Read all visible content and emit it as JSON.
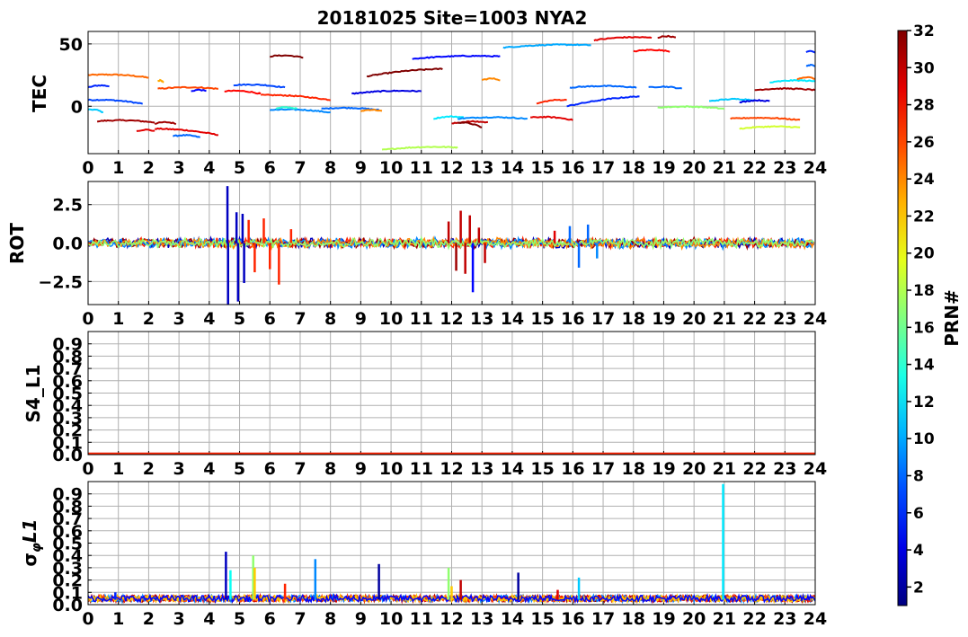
{
  "figure_title": "20181025 Site=1003 NYA2",
  "colorbar": {
    "label": "PRN#",
    "colormap": "jet",
    "range": [
      1,
      32
    ],
    "ticks": [
      2,
      4,
      6,
      8,
      10,
      12,
      14,
      16,
      18,
      20,
      22,
      24,
      26,
      28,
      30,
      32
    ],
    "tick_labels": [
      "2",
      "4",
      "6",
      "8",
      "10",
      "12",
      "14",
      "16",
      "18",
      "20",
      "22",
      "24",
      "26",
      "28",
      "30",
      "32"
    ]
  },
  "chart_data": [
    {
      "type": "line",
      "ylabel": "TEC",
      "xlim": [
        0,
        24
      ],
      "ylim": [
        -38,
        60
      ],
      "x_ticks": [
        "0",
        "1",
        "2",
        "3",
        "4",
        "5",
        "6",
        "7",
        "8",
        "9",
        "10",
        "11",
        "12",
        "13",
        "14",
        "15",
        "16",
        "17",
        "18",
        "19",
        "20",
        "21",
        "22",
        "23",
        "24"
      ],
      "y_ticks": [
        0,
        50
      ],
      "y_tick_labels": [
        "0",
        "50"
      ],
      "grid": true,
      "segments": [
        {
          "prn": 25,
          "x0": 0.0,
          "x1": 2.0,
          "y0": 25,
          "y1": 23
        },
        {
          "prn": 6,
          "x0": 0.0,
          "x1": 0.7,
          "y0": 15,
          "y1": 16
        },
        {
          "prn": 7,
          "x0": 0.0,
          "x1": 1.8,
          "y0": 5,
          "y1": 2
        },
        {
          "prn": 11,
          "x0": 0.0,
          "x1": 0.5,
          "y0": -3,
          "y1": -5
        },
        {
          "prn": 31,
          "x0": 0.3,
          "x1": 2.2,
          "y0": -12,
          "y1": -13
        },
        {
          "prn": 31,
          "x0": 2.2,
          "x1": 2.9,
          "y0": -14,
          "y1": -14
        },
        {
          "prn": 29,
          "x0": 1.6,
          "x1": 2.2,
          "y0": -20,
          "y1": -20
        },
        {
          "prn": 29,
          "x0": 2.2,
          "x1": 4.3,
          "y0": -18,
          "y1": -23
        },
        {
          "prn": 8,
          "x0": 2.8,
          "x1": 3.7,
          "y0": -24,
          "y1": -25
        },
        {
          "prn": 23,
          "x0": 2.3,
          "x1": 2.5,
          "y0": 20,
          "y1": 19
        },
        {
          "prn": 26,
          "x0": 2.3,
          "x1": 4.3,
          "y0": 14,
          "y1": 14
        },
        {
          "prn": 5,
          "x0": 3.4,
          "x1": 3.9,
          "y0": 12,
          "y1": 12
        },
        {
          "prn": 28,
          "x0": 4.5,
          "x1": 5.7,
          "y0": 12,
          "y1": 10
        },
        {
          "prn": 27,
          "x0": 5.7,
          "x1": 8.0,
          "y0": 9,
          "y1": 5
        },
        {
          "prn": 7,
          "x0": 4.8,
          "x1": 6.5,
          "y0": 17,
          "y1": 15
        },
        {
          "prn": 32,
          "x0": 6.0,
          "x1": 7.1,
          "y0": 40,
          "y1": 39
        },
        {
          "prn": 9,
          "x0": 6.0,
          "x1": 8.0,
          "y0": -3,
          "y1": -5
        },
        {
          "prn": 14,
          "x0": 6.2,
          "x1": 6.9,
          "y0": -2,
          "y1": -2
        },
        {
          "prn": 8,
          "x0": 7.7,
          "x1": 9.6,
          "y0": -2,
          "y1": -3
        },
        {
          "prn": 24,
          "x0": 9.0,
          "x1": 9.7,
          "y0": -4,
          "y1": -4
        },
        {
          "prn": 4,
          "x0": 8.7,
          "x1": 11.0,
          "y0": 10,
          "y1": 12
        },
        {
          "prn": 32,
          "x0": 9.2,
          "x1": 11.7,
          "y0": 24,
          "y1": 30
        },
        {
          "prn": 5,
          "x0": 10.7,
          "x1": 13.6,
          "y0": 38,
          "y1": 40
        },
        {
          "prn": 18,
          "x0": 9.7,
          "x1": 12.2,
          "y0": -35,
          "y1": -33
        },
        {
          "prn": 12,
          "x0": 11.4,
          "x1": 12.4,
          "y0": -10,
          "y1": -9
        },
        {
          "prn": 9,
          "x0": 12.2,
          "x1": 14.5,
          "y0": -10,
          "y1": -10
        },
        {
          "prn": 30,
          "x0": 12.0,
          "x1": 13.2,
          "y0": -14,
          "y1": -13
        },
        {
          "prn": 32,
          "x0": 12.2,
          "x1": 13.0,
          "y0": -13,
          "y1": -17
        },
        {
          "prn": 24,
          "x0": 13.0,
          "x1": 13.6,
          "y0": 21,
          "y1": 21
        },
        {
          "prn": 10,
          "x0": 13.7,
          "x1": 16.6,
          "y0": 47,
          "y1": 49
        },
        {
          "prn": 29,
          "x0": 14.6,
          "x1": 16.0,
          "y0": -9,
          "y1": -11
        },
        {
          "prn": 27,
          "x0": 14.8,
          "x1": 15.8,
          "y0": 2,
          "y1": 5
        },
        {
          "prn": 29,
          "x0": 16.7,
          "x1": 18.6,
          "y0": 53,
          "y1": 55
        },
        {
          "prn": 31,
          "x0": 18.8,
          "x1": 19.4,
          "y0": 55,
          "y1": 55
        },
        {
          "prn": 28,
          "x0": 18.0,
          "x1": 19.2,
          "y0": 44,
          "y1": 44
        },
        {
          "prn": 8,
          "x0": 15.9,
          "x1": 18.1,
          "y0": 15,
          "y1": 15
        },
        {
          "prn": 6,
          "x0": 15.8,
          "x1": 18.2,
          "y0": 0,
          "y1": 8
        },
        {
          "prn": 8,
          "x0": 18.5,
          "x1": 19.6,
          "y0": 15,
          "y1": 14
        },
        {
          "prn": 17,
          "x0": 18.8,
          "x1": 21.0,
          "y0": -1,
          "y1": -2
        },
        {
          "prn": 11,
          "x0": 20.5,
          "x1": 22.0,
          "y0": 4,
          "y1": 5
        },
        {
          "prn": 4,
          "x0": 21.5,
          "x1": 22.5,
          "y0": 3,
          "y1": 4
        },
        {
          "prn": 31,
          "x0": 22.0,
          "x1": 24.0,
          "y0": 13,
          "y1": 13
        },
        {
          "prn": 26,
          "x0": 21.2,
          "x1": 23.5,
          "y0": -10,
          "y1": -11
        },
        {
          "prn": 19,
          "x0": 21.5,
          "x1": 23.5,
          "y0": -18,
          "y1": -17
        },
        {
          "prn": 12,
          "x0": 22.5,
          "x1": 24.0,
          "y0": 19,
          "y1": 20
        },
        {
          "prn": 25,
          "x0": 23.4,
          "x1": 24.0,
          "y0": 22,
          "y1": 22
        },
        {
          "prn": 8,
          "x0": 23.7,
          "x1": 24.0,
          "y0": 32,
          "y1": 32
        },
        {
          "prn": 6,
          "x0": 23.7,
          "x1": 24.0,
          "y0": 43,
          "y1": 43
        }
      ]
    },
    {
      "type": "line",
      "ylabel": "ROT",
      "xlim": [
        0,
        24
      ],
      "ylim": [
        -4,
        4
      ],
      "x_ticks": [
        "0",
        "1",
        "2",
        "3",
        "4",
        "5",
        "6",
        "7",
        "8",
        "9",
        "10",
        "11",
        "12",
        "13",
        "14",
        "15",
        "16",
        "17",
        "18",
        "19",
        "20",
        "21",
        "22",
        "23",
        "24"
      ],
      "y_ticks": [
        -2.5,
        0.0,
        2.5
      ],
      "y_tick_labels": [
        "−2.5",
        "0.0",
        "2.5"
      ],
      "grid": true,
      "baseline_noise": 0.25,
      "spikes": [
        {
          "x": 4.6,
          "y": 3.7,
          "prn": 3
        },
        {
          "x": 4.62,
          "y": -4.0,
          "prn": 3
        },
        {
          "x": 4.9,
          "y": 2.0,
          "prn": 3
        },
        {
          "x": 4.95,
          "y": -3.8,
          "prn": 3
        },
        {
          "x": 5.1,
          "y": 1.9,
          "prn": 3
        },
        {
          "x": 5.15,
          "y": -2.6,
          "prn": 3
        },
        {
          "x": 5.3,
          "y": 1.5,
          "prn": 27
        },
        {
          "x": 5.5,
          "y": -1.9,
          "prn": 27
        },
        {
          "x": 5.8,
          "y": 1.6,
          "prn": 27
        },
        {
          "x": 6.0,
          "y": -1.7,
          "prn": 27
        },
        {
          "x": 6.3,
          "y": -2.7,
          "prn": 27
        },
        {
          "x": 6.7,
          "y": 0.9,
          "prn": 27
        },
        {
          "x": 11.9,
          "y": 1.4,
          "prn": 30
        },
        {
          "x": 12.15,
          "y": -1.8,
          "prn": 31
        },
        {
          "x": 12.3,
          "y": 2.1,
          "prn": 30
        },
        {
          "x": 12.45,
          "y": -2.0,
          "prn": 30
        },
        {
          "x": 12.6,
          "y": 1.8,
          "prn": 30
        },
        {
          "x": 12.7,
          "y": -3.2,
          "prn": 5
        },
        {
          "x": 12.9,
          "y": 1.0,
          "prn": 30
        },
        {
          "x": 13.1,
          "y": -1.3,
          "prn": 30
        },
        {
          "x": 15.9,
          "y": 1.1,
          "prn": 8
        },
        {
          "x": 16.2,
          "y": -1.6,
          "prn": 8
        },
        {
          "x": 16.5,
          "y": 1.2,
          "prn": 8
        },
        {
          "x": 16.8,
          "y": -1.0,
          "prn": 9
        },
        {
          "x": 15.4,
          "y": 0.8,
          "prn": 29
        }
      ]
    },
    {
      "type": "line",
      "ylabel": "S4_L1",
      "xlim": [
        0,
        24
      ],
      "ylim": [
        0.0,
        1.0
      ],
      "x_ticks": [
        "0",
        "1",
        "2",
        "3",
        "4",
        "5",
        "6",
        "7",
        "8",
        "9",
        "10",
        "11",
        "12",
        "13",
        "14",
        "15",
        "16",
        "17",
        "18",
        "19",
        "20",
        "21",
        "22",
        "23",
        "24"
      ],
      "y_ticks": [
        0.0,
        0.1,
        0.2,
        0.3,
        0.4,
        0.5,
        0.6,
        0.7,
        0.8,
        0.9
      ],
      "y_tick_labels": [
        "0.0",
        "0.1",
        "0.2",
        "0.3",
        "0.4",
        "0.5",
        "0.6",
        "0.7",
        "0.8",
        "0.9"
      ],
      "grid": true,
      "baseline_level": 0.01
    },
    {
      "type": "line",
      "ylabel": "σφL1",
      "ylabel_main": "σ",
      "ylabel_sub": "φ",
      "ylabel_tail": "L1",
      "xlim": [
        0,
        24
      ],
      "ylim": [
        0.0,
        1.0
      ],
      "x_ticks": [
        "0",
        "1",
        "2",
        "3",
        "4",
        "5",
        "6",
        "7",
        "8",
        "9",
        "10",
        "11",
        "12",
        "13",
        "14",
        "15",
        "16",
        "17",
        "18",
        "19",
        "20",
        "21",
        "22",
        "23",
        "24"
      ],
      "y_ticks": [
        0.0,
        0.1,
        0.2,
        0.3,
        0.4,
        0.5,
        0.6,
        0.7,
        0.8,
        0.9
      ],
      "y_tick_labels": [
        "0.0",
        "0.1",
        "0.2",
        "0.3",
        "0.4",
        "0.5",
        "0.6",
        "0.7",
        "0.8",
        "0.9"
      ],
      "grid": true,
      "baseline_level": 0.04,
      "spikes": [
        {
          "x": 0.9,
          "y": 0.1,
          "prn": 6
        },
        {
          "x": 4.55,
          "y": 0.43,
          "prn": 3
        },
        {
          "x": 4.7,
          "y": 0.28,
          "prn": 13
        },
        {
          "x": 5.45,
          "y": 0.4,
          "prn": 17
        },
        {
          "x": 5.5,
          "y": 0.3,
          "prn": 22
        },
        {
          "x": 6.5,
          "y": 0.17,
          "prn": 27
        },
        {
          "x": 7.5,
          "y": 0.37,
          "prn": 9
        },
        {
          "x": 9.6,
          "y": 0.33,
          "prn": 2
        },
        {
          "x": 11.9,
          "y": 0.3,
          "prn": 17
        },
        {
          "x": 12.3,
          "y": 0.2,
          "prn": 30
        },
        {
          "x": 14.2,
          "y": 0.26,
          "prn": 2
        },
        {
          "x": 16.2,
          "y": 0.22,
          "prn": 11
        },
        {
          "x": 20.96,
          "y": 0.98,
          "prn": 12
        },
        {
          "x": 12.0,
          "y": 0.15,
          "prn": 22
        },
        {
          "x": 15.5,
          "y": 0.12,
          "prn": 29
        }
      ]
    }
  ]
}
